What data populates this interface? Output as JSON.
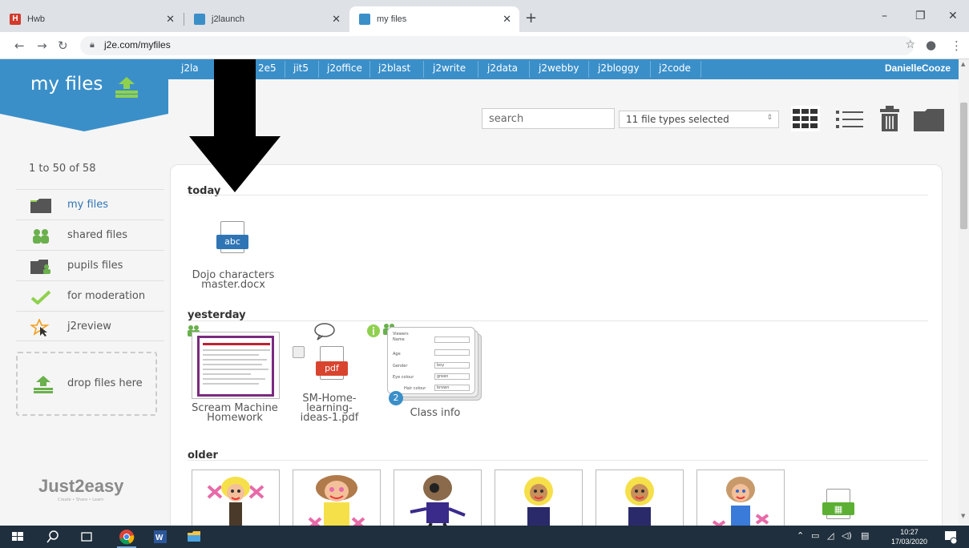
{
  "browser": {
    "tabs": [
      {
        "title": "Hwb",
        "favicon_color": "#d23a2b",
        "favicon_letter": "H"
      },
      {
        "title": "j2launch",
        "favicon_color": "#3a8fc9"
      },
      {
        "title": "my files",
        "favicon_color": "#3a8fc9",
        "active": true
      }
    ],
    "new_tab": "+",
    "url": "j2e.com/myfiles",
    "window_controls": [
      "–",
      "❐",
      "✕"
    ]
  },
  "topnav": {
    "items": [
      "j2launch",
      "j2e5",
      "jit5",
      "j2office",
      "j2blast",
      "j2write",
      "j2data",
      "j2webby",
      "j2bloggy",
      "j2code"
    ],
    "visible_items": [
      "j2la",
      "2e5",
      "jit5",
      "j2office",
      "j2blast",
      "j2write",
      "j2data",
      "j2webby",
      "j2bloggy",
      "j2code"
    ],
    "user": "DanielleCooze"
  },
  "brand": {
    "title": "my files"
  },
  "toolbar": {
    "search_placeholder": "search",
    "file_types": "11 file types selected"
  },
  "sidebar": {
    "count": "1 to 50 of 58",
    "items": [
      {
        "label": "my files",
        "icon": "folder-icon"
      },
      {
        "label": "shared files",
        "icon": "people-icon"
      },
      {
        "label": "pupils files",
        "icon": "pupils-folder-icon"
      },
      {
        "label": "for moderation",
        "icon": "checkmark-icon"
      },
      {
        "label": "j2review",
        "icon": "star-cursor-icon"
      }
    ],
    "drop_label": "drop files here",
    "logo": "Just2easy",
    "tagline": "Create • Share • Learn"
  },
  "sections": {
    "today": "today",
    "yesterday": "yesterday",
    "older": "older"
  },
  "files": {
    "today": [
      {
        "name_line1": "Dojo characters",
        "name_line2": "master.docx",
        "badge": "abc",
        "badge_color": "#2f75b5"
      }
    ],
    "yesterday": [
      {
        "name_line1": "Scream Machine",
        "name_line2": "Homework"
      },
      {
        "name_line1": "SM-Home-",
        "name_line2": "learning-",
        "name_line3": "ideas-1.pdf",
        "badge": "pdf",
        "badge_color": "#d9442f"
      },
      {
        "name_line1": "Class info",
        "count_badge": "2",
        "form_fields": [
          "Name",
          "Age",
          "Gender",
          "Eye colour",
          "Hair colour"
        ],
        "form_values": [
          "",
          "",
          "boy",
          "green",
          "brown"
        ],
        "form_header": "Viewers"
      }
    ]
  },
  "taskbar": {
    "time": "10:27",
    "date": "17/03/2020"
  }
}
